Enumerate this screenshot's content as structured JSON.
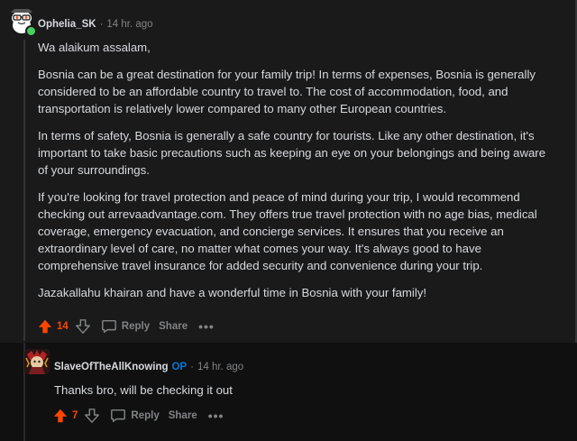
{
  "comment": {
    "username": "Ophelia_SK",
    "time": "14 hr. ago",
    "paragraphs": [
      "Wa alaikum assalam,",
      "Bosnia can be a great destination for your family trip! In terms of expenses, Bosnia is generally considered to be an affordable country to travel to. The cost of accommodation, food, and transportation is relatively lower compared to many other European countries.",
      "In terms of safety, Bosnia is generally a safe country for tourists. Like any other destination, it's important to take basic precautions such as keeping an eye on your belongings and being aware of your surroundings.",
      "If you're looking for travel protection and peace of mind during your trip, I would recommend checking out arrevaadvantage.com. They offers true travel protection with no age bias, medical coverage, emergency evacuation, and concierge services. It ensures that you receive an extraordinary level of care, no matter what comes your way. It's always good to have comprehensive travel insurance for added security and convenience during your trip.",
      "Jazakallahu khairan and have a wonderful time in Bosnia with your family!"
    ],
    "score": "14",
    "reply_label": "Reply",
    "share_label": "Share",
    "more_label": "•••",
    "upvoted": true
  },
  "reply": {
    "username": "SlaveOfTheAllKnowing",
    "op_badge": "OP",
    "time": "14 hr. ago",
    "text": "Thanks bro, will be checking it out",
    "score": "7",
    "reply_label": "Reply",
    "share_label": "Share",
    "more_label": "•••",
    "upvoted": true
  },
  "separator": "·",
  "colors": {
    "background": "#1a1a1b",
    "text": "#d7dadc",
    "muted": "#818384",
    "upvote": "#ff4500",
    "op": "#0079d3",
    "online": "#46d160"
  },
  "icons": {
    "upvote": "arrow-up-icon",
    "downvote": "arrow-down-icon",
    "reply": "speech-bubble-icon",
    "more": "more-dots-icon"
  }
}
